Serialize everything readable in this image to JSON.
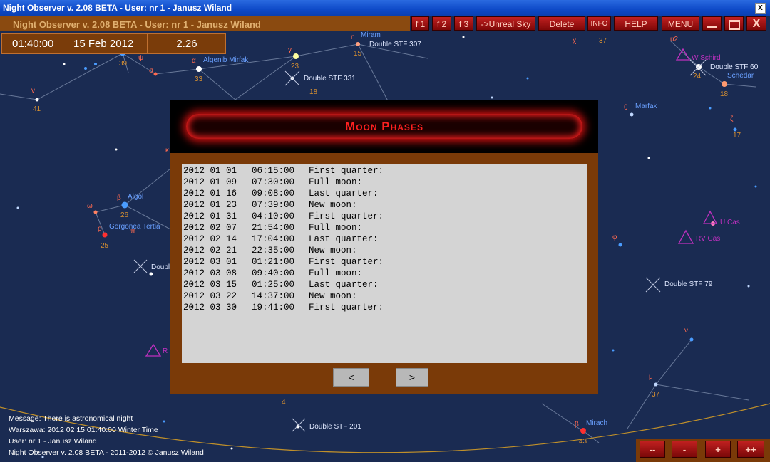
{
  "window": {
    "title": "Night Observer v. 2.08 BETA -  User:  nr 1 - Janusz Wiland",
    "close_label": "X"
  },
  "header": {
    "title": "Night Observer v. 2.08 BETA -  User:  nr 1 - Janusz Wiland",
    "time": "01:40:00",
    "date": "15 Feb 2012",
    "value": "2.26"
  },
  "toolbar": {
    "f1": "f 1",
    "f2": "f 2",
    "f3": "f 3",
    "unreal": "->Unreal Sky",
    "delete": "Delete",
    "info": "INFO",
    "help": "HELP",
    "menu": "MENU",
    "close": "X"
  },
  "sky_labels": {
    "mirach_top": "Miram",
    "double_stf_307": "Double STF 307",
    "algenib": "Algenib Mirfak",
    "double_stf_331": "Double STF 331",
    "w_schird": "W Schird",
    "double_stf_60": "Double STF  60",
    "schedar": "Schedar",
    "marfak": "Marfak",
    "algol": "Algol",
    "gorgonea": "Gorgonea Tertia",
    "u_cas": "U Cas",
    "rv_cas": "RV Cas",
    "double_left": "Doubl",
    "double_stf_79": "Double STF  79",
    "double_stf_201": "Double STF 201",
    "mirach": "Mirach",
    "r_label": "R",
    "nums": [
      "39",
      "33",
      "23",
      "15",
      "18",
      "41",
      "37",
      "24",
      "18",
      "17",
      "26",
      "25",
      "43",
      "37",
      "4"
    ],
    "greek": [
      "ν",
      "ψ",
      "σ",
      "α",
      "γ",
      "η",
      "χ",
      "υ2",
      "θ",
      "ζ",
      "κ",
      "β",
      "ω",
      "ρ",
      "π",
      "φ",
      "ν",
      "μ",
      "β"
    ]
  },
  "panel": {
    "title": "Moon Phases",
    "rows": [
      {
        "date": "2012 01 01",
        "time": "06:15:00",
        "phase": "First quarter:"
      },
      {
        "date": "2012 01 09",
        "time": "07:30:00",
        "phase": "Full moon:"
      },
      {
        "date": "2012 01 16",
        "time": "09:08:00",
        "phase": "Last quarter:"
      },
      {
        "date": "2012 01 23",
        "time": "07:39:00",
        "phase": "New moon:"
      },
      {
        "date": "2012 01 31",
        "time": "04:10:00",
        "phase": "First quarter:"
      },
      {
        "date": "2012 02 07",
        "time": "21:54:00",
        "phase": "Full moon:"
      },
      {
        "date": "2012 02 14",
        "time": "17:04:00",
        "phase": "Last quarter:"
      },
      {
        "date": "2012 02 21",
        "time": "22:35:00",
        "phase": "New moon:"
      },
      {
        "date": "2012 03 01",
        "time": "01:21:00",
        "phase": "First quarter:"
      },
      {
        "date": "2012 03 08",
        "time": "09:40:00",
        "phase": "Full moon:"
      },
      {
        "date": "2012 03 15",
        "time": "01:25:00",
        "phase": "Last quarter:"
      },
      {
        "date": "2012 03 22",
        "time": "14:37:00",
        "phase": "New moon:"
      },
      {
        "date": "2012 03 30",
        "time": "19:41:00",
        "phase": "First quarter:"
      }
    ],
    "prev": "<",
    "next": ">"
  },
  "status": {
    "message": "Message: There is astronomical night",
    "location": "Warszawa:  2012 02 15  01:40:00 Winter Time",
    "user": "User:  nr 1 - Janusz Wiland",
    "copyright": "Night Observer v. 2.08 BETA - 2011-2012 © Janusz Wiland"
  },
  "zoom": {
    "zoom_out_more": "-- ",
    "zoom_out": "-",
    "zoom_in": "+",
    "zoom_in_more": "++"
  },
  "colors": {
    "accent": "#ff2020",
    "panel": "#7a3a08",
    "sky": "#1a2b52",
    "label": "#d89030"
  }
}
